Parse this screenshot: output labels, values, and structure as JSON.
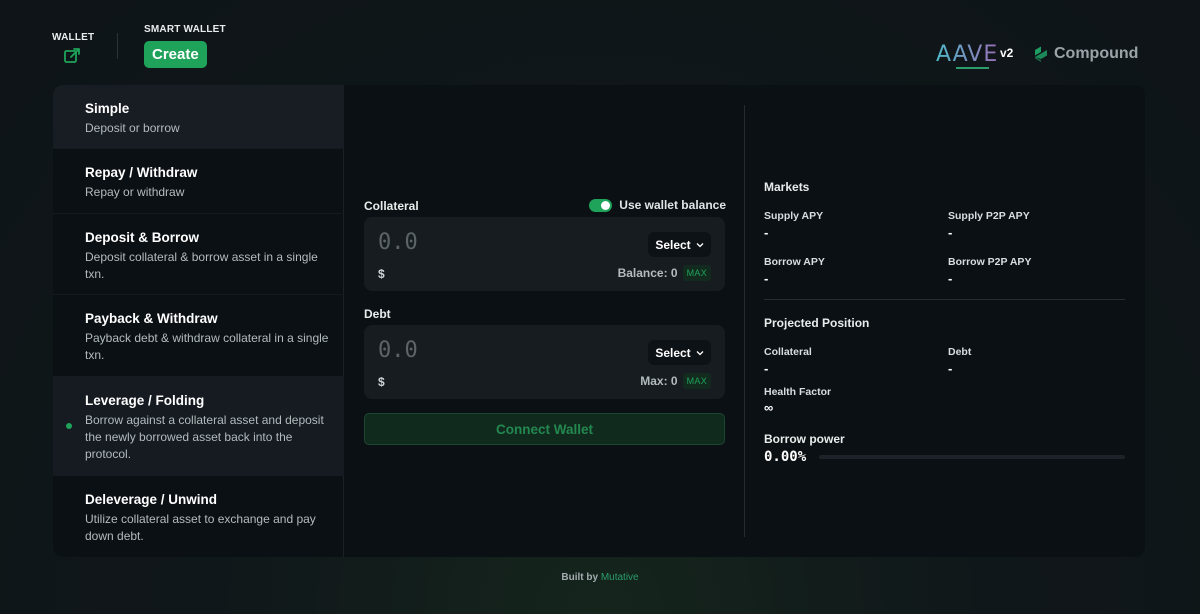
{
  "header": {
    "wallet_label": "WALLET",
    "smart_wallet_label": "SMART WALLET",
    "create_label": "Create",
    "aave_logo": "AAVE",
    "aave_version": "v2",
    "compound_logo": "Compound"
  },
  "sidebar": {
    "items": [
      {
        "title": "Simple",
        "desc": "Deposit or borrow"
      },
      {
        "title": "Repay / Withdraw",
        "desc": "Repay or withdraw"
      },
      {
        "title": "Deposit & Borrow",
        "desc": "Deposit collateral & borrow asset in a single txn."
      },
      {
        "title": "Payback & Withdraw",
        "desc": "Payback debt & withdraw collateral in a single txn."
      },
      {
        "title": "Leverage / Folding",
        "desc": "Borrow against a collateral asset and deposit the newly borrowed asset back into the protocol."
      },
      {
        "title": "Deleverage / Unwind",
        "desc": "Utilize collateral asset to exchange and pay down debt."
      }
    ]
  },
  "form": {
    "collateral_label": "Collateral",
    "use_wallet_balance": "Use wallet balance",
    "collateral_amount": "0.0",
    "collateral_select": "Select",
    "collateral_dollar": "$",
    "balance_label": "Balance: 0",
    "debt_label": "Debt",
    "debt_amount": "0.0",
    "debt_select": "Select",
    "debt_dollar": "$",
    "max_text": "Max: 0",
    "max_badge": "MAX",
    "connect_label": "Connect Wallet"
  },
  "markets": {
    "heading": "Markets",
    "supply_apy_label": "Supply APY",
    "supply_apy": "-",
    "supply_p2p_label": "Supply P2P APY",
    "supply_p2p": "-",
    "borrow_apy_label": "Borrow APY",
    "borrow_apy": "-",
    "borrow_p2p_label": "Borrow P2P APY",
    "borrow_p2p": "-"
  },
  "projected": {
    "heading": "Projected Position",
    "collateral_label": "Collateral",
    "collateral": "-",
    "debt_label": "Debt",
    "debt": "-",
    "health_label": "Health Factor",
    "health": "∞",
    "borrow_power_label": "Borrow power",
    "borrow_power": "0.00%",
    "borrow_power_fraction": 0
  },
  "footer": {
    "built_by": "Built by",
    "brand": "Mutative"
  },
  "colors": {
    "accent": "#1fa35a",
    "background": "#0b1014",
    "panel": "#171c21"
  }
}
